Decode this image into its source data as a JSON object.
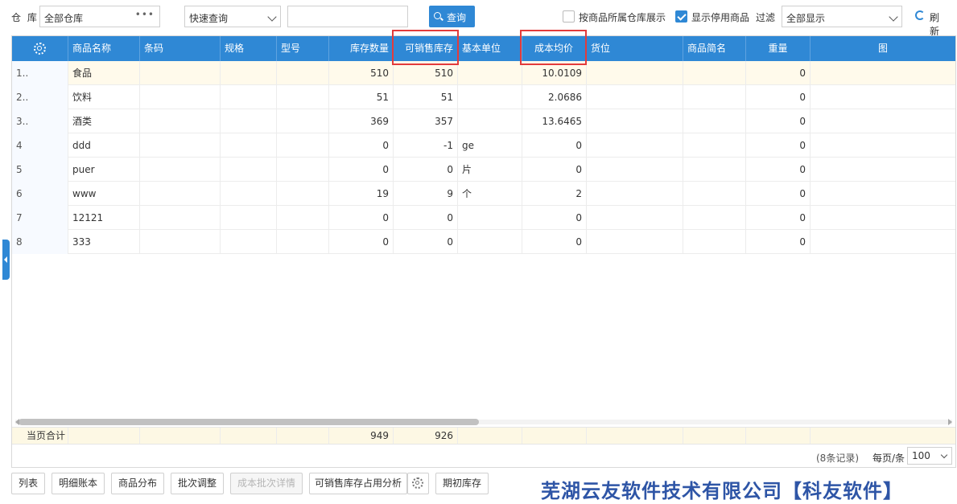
{
  "toolbar": {
    "warehouse_label": "仓 库",
    "warehouse_value": "全部仓库",
    "warehouse_more": "•••",
    "query_mode": "快速查询",
    "search_value": "",
    "query_button": "查询",
    "by_warehouse_label": "按商品所属仓库展示",
    "by_warehouse_checked": false,
    "show_disabled_label": "显示停用商品",
    "show_disabled_checked": true,
    "filter_label": "过滤",
    "filter_value": "全部显示",
    "refresh_label": "刷新"
  },
  "columns": {
    "name": "商品名称",
    "barcode": "条码",
    "spec": "规格",
    "model": "型号",
    "stock_qty": "库存数量",
    "sellable": "可销售库存",
    "base_unit": "基本单位",
    "avg_cost": "成本均价",
    "location": "货位",
    "short_name": "商品简名",
    "weight": "重量",
    "image": "图"
  },
  "rows": [
    {
      "idx": "1..",
      "name": "食品",
      "stock_qty": "510",
      "sellable": "510",
      "unit": "",
      "avg_cost": "10.0109",
      "weight": "0"
    },
    {
      "idx": "2..",
      "name": "饮料",
      "stock_qty": "51",
      "sellable": "51",
      "unit": "",
      "avg_cost": "2.0686",
      "weight": "0"
    },
    {
      "idx": "3..",
      "name": "酒类",
      "stock_qty": "369",
      "sellable": "357",
      "unit": "",
      "avg_cost": "13.6465",
      "weight": "0"
    },
    {
      "idx": "4",
      "name": "ddd",
      "stock_qty": "0",
      "sellable": "-1",
      "unit": "ge",
      "avg_cost": "0",
      "weight": "0"
    },
    {
      "idx": "5",
      "name": "puer",
      "stock_qty": "0",
      "sellable": "0",
      "unit": "片",
      "avg_cost": "0",
      "weight": "0"
    },
    {
      "idx": "6",
      "name": "www",
      "stock_qty": "19",
      "sellable": "9",
      "unit": "个",
      "avg_cost": "2",
      "weight": "0"
    },
    {
      "idx": "7",
      "name": "12121",
      "stock_qty": "0",
      "sellable": "0",
      "unit": "",
      "avg_cost": "0",
      "weight": "0"
    },
    {
      "idx": "8",
      "name": "333",
      "stock_qty": "0",
      "sellable": "0",
      "unit": "",
      "avg_cost": "0",
      "weight": "0"
    }
  ],
  "footer": {
    "label": "当页合计",
    "stock_qty_total": "949",
    "sellable_total": "926"
  },
  "pager": {
    "records": "(8条记录)",
    "per_page_label": "每页/条",
    "per_page_value": "100"
  },
  "actions": {
    "list": "列表",
    "ledger": "明细账本",
    "distribution": "商品分布",
    "batch_adjust": "批次调整",
    "cost_batch_detail": "成本批次详情",
    "sellable_analysis": "可销售库存占用分析",
    "opening_stock": "期初库存"
  },
  "company": "芜湖云友软件技术有限公司【科友软件】",
  "colors": {
    "header_blue": "#2f88d5",
    "highlight_red": "#e33b3b",
    "company_blue": "#2e55a6"
  }
}
